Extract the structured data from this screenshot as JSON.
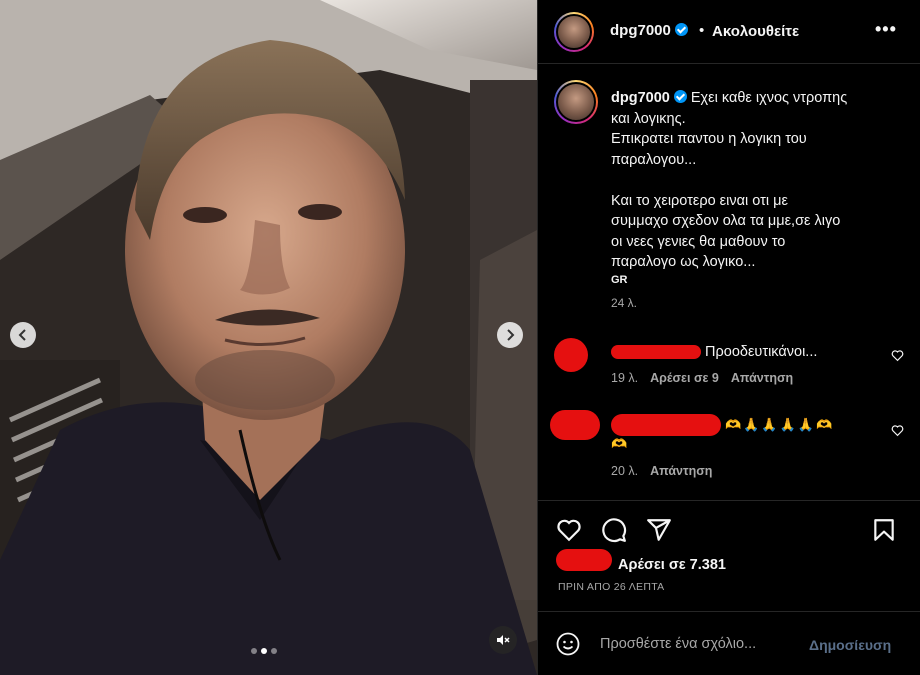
{
  "post": {
    "username": "dpg7000",
    "follow_separator": "•",
    "follow_status": "Ακολουθείτε",
    "more_icon": "more-options-icon"
  },
  "caption": {
    "username": "dpg7000",
    "lines": [
      "Εχει καθε ιχνος ντροπης",
      "και λογικης.",
      "Επικρατει παντου η λογικη του",
      "παραλογου...",
      "",
      "Και το χειροτερο ειναι οτι με",
      "συμμαχο σχεδον ολα τα μμε,σε λιγο",
      "οι νεες γενιες θα μαθουν το",
      "παραλογο ως λογικο..."
    ],
    "lang": "GR",
    "time": "24 λ."
  },
  "comments": [
    {
      "text": "Προοδευτικάνοι...",
      "time": "19 λ.",
      "likes": "Αρέσει σε 9",
      "reply": "Απάντηση"
    },
    {
      "text": "🫶🙏🙏🙏🙏🫶",
      "text2": "🫶",
      "time": "20 λ.",
      "reply": "Απάντηση"
    }
  ],
  "actions": {
    "likes": "Αρέσει σε 7.381",
    "ago": "ΠΡΙΝ ΑΠΟ 26 ΛΕΠΤΑ"
  },
  "composer": {
    "placeholder": "Προσθέστε ένα σχόλιο...",
    "post_label": "Δημοσίευση"
  },
  "carousel": {
    "total": 3,
    "active": 2
  },
  "colors": {
    "background": "#000000",
    "text": "#f5f5f5",
    "secondary_text": "#a8a8a8",
    "verified": "#0095f6",
    "redaction": "#e51010",
    "post_disabled": "#5a6f8a"
  }
}
